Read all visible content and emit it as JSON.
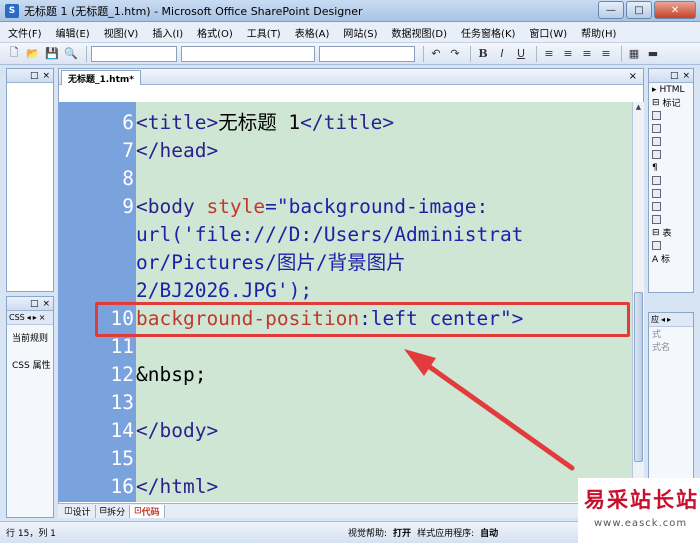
{
  "window": {
    "title": "无标题 1 (无标题_1.htm) - Microsoft Office SharePoint Designer",
    "minimize": "—",
    "maximize": "□",
    "close": "✕"
  },
  "menu": {
    "items": [
      "文件(F)",
      "编辑(E)",
      "视图(V)",
      "插入(I)",
      "格式(O)",
      "工具(T)",
      "表格(A)",
      "网站(S)",
      "数据视图(D)",
      "任务窗格(K)",
      "窗口(W)",
      "帮助(H)"
    ]
  },
  "toolbar": {
    "bold": "B",
    "italic": "I",
    "underline": "U"
  },
  "document": {
    "tab_label": "无标题_1.htm*",
    "close_glyph": "×"
  },
  "code_lines": [
    {
      "num": "6",
      "parts": [
        {
          "t": "<title>",
          "c": "tag"
        },
        {
          "t": "无标题 1",
          "c": "plain"
        },
        {
          "t": "</title>",
          "c": "tag"
        }
      ]
    },
    {
      "num": "7",
      "parts": [
        {
          "t": "</head>",
          "c": "tag"
        }
      ]
    },
    {
      "num": "8",
      "parts": []
    },
    {
      "num": "9",
      "parts": [
        {
          "t": "<body ",
          "c": "tag"
        },
        {
          "t": "style",
          "c": "attr"
        },
        {
          "t": "=\"background-image:",
          "c": "str"
        }
      ]
    },
    {
      "num": "",
      "parts": [
        {
          "t": "url('file:///D:/Users/Administrat",
          "c": "str"
        }
      ]
    },
    {
      "num": "",
      "parts": [
        {
          "t": "or/Pictures/图片/背景图片",
          "c": "str"
        }
      ]
    },
    {
      "num": "",
      "parts": [
        {
          "t": "2/BJ2026.JPG');",
          "c": "str"
        }
      ]
    },
    {
      "num": "10",
      "parts": [
        {
          "t": "background-position",
          "c": "attr"
        },
        {
          "t": ":left center\">",
          "c": "str"
        }
      ]
    },
    {
      "num": "11",
      "parts": []
    },
    {
      "num": "12",
      "parts": [
        {
          "t": "&nbsp;",
          "c": "plain"
        }
      ]
    },
    {
      "num": "13",
      "parts": []
    },
    {
      "num": "14",
      "parts": [
        {
          "t": "</body>",
          "c": "tag"
        }
      ]
    },
    {
      "num": "15",
      "parts": []
    },
    {
      "num": "16",
      "parts": [
        {
          "t": "</html>",
          "c": "tag"
        }
      ]
    }
  ],
  "view_tabs": [
    "设计",
    "拆分",
    "代码"
  ],
  "left_panel": {
    "tab": "CSS",
    "items": [
      "当前规则",
      "CSS 属性"
    ]
  },
  "right_panel": {
    "top_header": "HTML",
    "top_rows": [
      "标记",
      "表",
      "A 标"
    ],
    "bottom_header": "应",
    "bottom_rows": [
      "式",
      "式名"
    ]
  },
  "status": {
    "position": "行 15，列 1",
    "visual_aid_label": "视觉帮助:",
    "visual_aid_value": "打开",
    "style_app_label": "样式应用程序:",
    "style_app_value": "自动"
  },
  "watermark": {
    "text": "易采站长站",
    "url": "www.easck.com"
  },
  "colors": {
    "code_bg": "#cfe6d4",
    "gutter_bg": "#7aa2dd",
    "highlight": "#e23b3b",
    "arrow": "#e23b3b"
  }
}
